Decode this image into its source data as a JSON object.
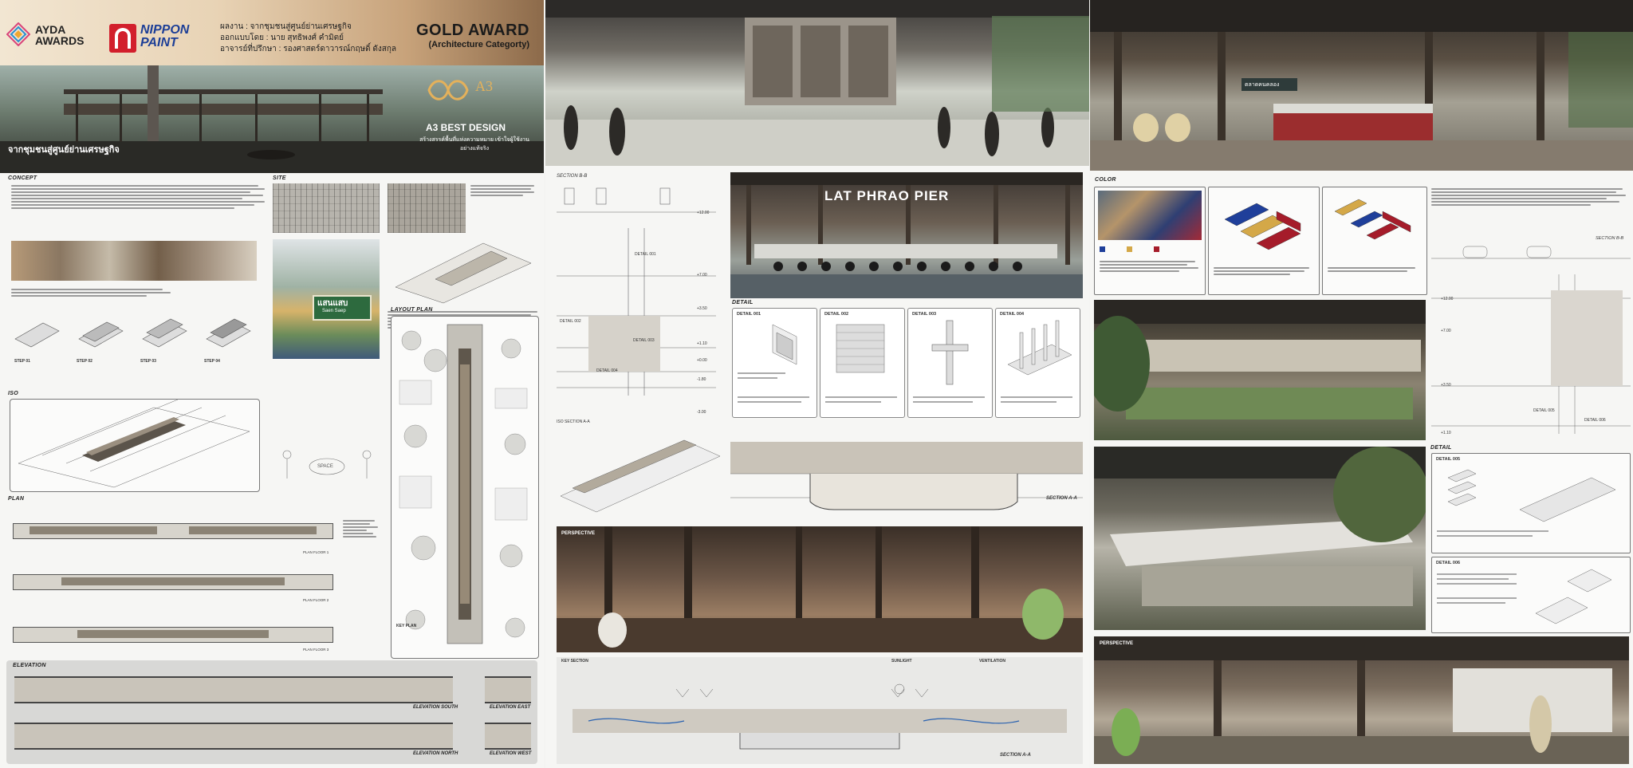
{
  "header": {
    "ayda_logo": "AYDA AWARDS",
    "nippon_logo": "NIPPON PAINT",
    "credits": [
      "ผลงาน : จากชุมชนสู่ศูนย์ย่านเศรษฐกิจ",
      "ออกแบบโดย : นาย สุทธิพงศ์ คำมิตย์",
      "อาจารย์ที่ปรึกษา : รองศาสตร์ดาวารณ์กฤษดิ์ ดังสกุล"
    ],
    "award_title": "GOLD AWARD",
    "award_subtitle": "(Architecture Categorty)"
  },
  "board1": {
    "hero_title": "จากชุมชนสู่ศูนย์ย่านเศรษฐกิจ",
    "a3_mark": "A3",
    "a3_label": "A3 BEST DESIGN",
    "a3_tagline": "สร้างสรรค์พื้นที่แห่งความหมาย เข้าใจผู้ใช้งานอย่างแท้จริง",
    "sections": {
      "concept": "CONCEPT",
      "site": "SITE",
      "iso": "ISO",
      "plan": "PLAN",
      "layout_plan": "LAYOUT PLAN",
      "elevation": "ELEVATION"
    },
    "steps": [
      "STEP 01",
      "STEP 02",
      "STEP 03",
      "STEP 04"
    ],
    "space_label": "SPACE",
    "plan_levels": [
      "PLAN FLOOR 1",
      "PLAN FLOOR 2",
      "PLAN FLOOR 3"
    ],
    "key_plan": "KEY PLAN",
    "sign_label": "แสนแสบ",
    "sign_sub": "Saen Saep",
    "elevations": [
      "ELEVATION SOUTH",
      "ELEVATION EAST",
      "ELEVATION NORTH",
      "ELEVATION WEST"
    ]
  },
  "board2": {
    "section_bb": "SECTION B-B",
    "pier_title": "LAT PHRAO PIER",
    "detail_heading": "DETAIL",
    "details": [
      "DETAIL 001",
      "DETAIL 002",
      "DETAIL 003",
      "DETAIL 004"
    ],
    "iso_section": "ISO SECTION A-A",
    "section_aa": "SECTION A-A",
    "perspective": "PERSPECTIVE",
    "levels": [
      "+12.00",
      "+7.00",
      "+3.50",
      "+1.10",
      "+0.00",
      "-1.80",
      "-3.00"
    ],
    "detail_callouts": [
      "DETAIL 001",
      "DETAIL 002",
      "DETAIL 003",
      "DETAIL 004"
    ],
    "bottom_labels": [
      "KEY SECTION",
      "SUNLIGHT",
      "VENTILATION"
    ]
  },
  "board3": {
    "market_sign": "ตลาดคนคลอง",
    "color_heading": "COLOR",
    "section_bb": "SECTION B-B",
    "detail_heading": "DETAIL",
    "details": [
      "DETAIL 005",
      "DETAIL 006"
    ],
    "perspective": "PERSPECTIVE",
    "levels": [
      "+12.00",
      "+7.00",
      "+3.50",
      "+1.10"
    ],
    "detail_callouts": [
      "DETAIL 005",
      "DETAIL 006"
    ],
    "swatches": [
      {
        "color": "#1f3f9a"
      },
      {
        "color": "#d4a848"
      },
      {
        "color": "#a51c2a"
      }
    ],
    "photo_colors": {
      "blue": "#1f3f9a",
      "gold": "#d4a848",
      "red": "#a51c2a"
    }
  }
}
